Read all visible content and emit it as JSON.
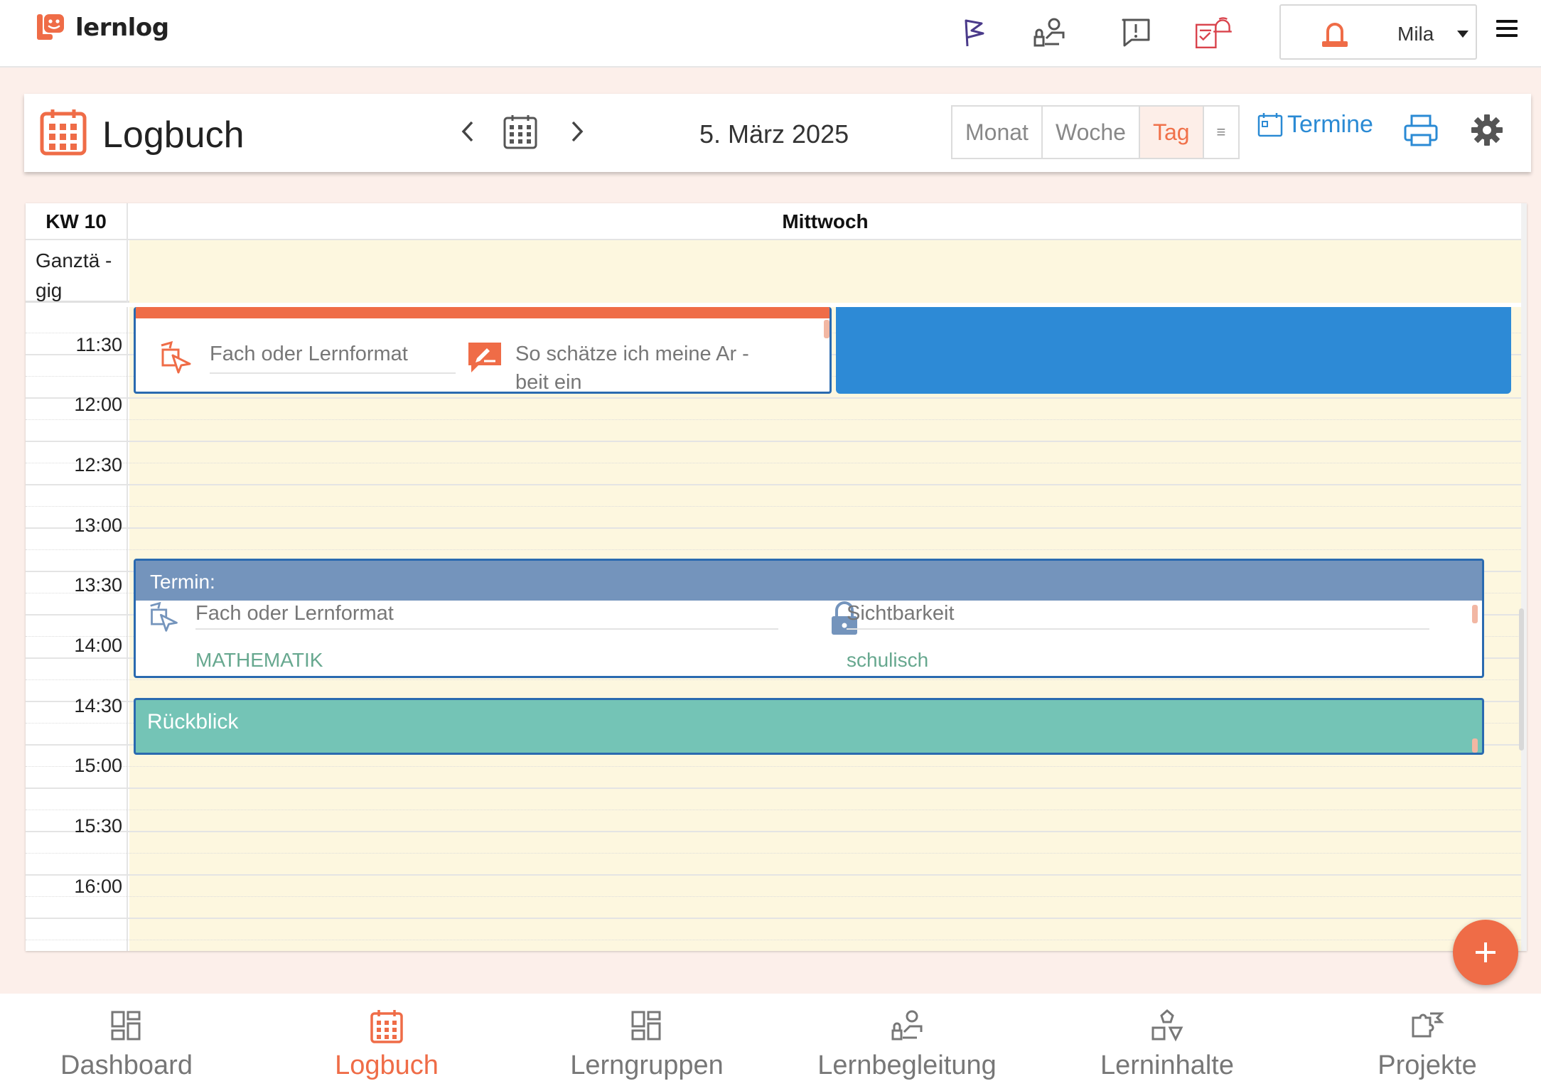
{
  "app": {
    "name": "lernlog"
  },
  "user": {
    "name": "Mila"
  },
  "header": {
    "title": "Logbuch",
    "date": "5. März 2025",
    "views": [
      "Monat",
      "Woche",
      "Tag",
      "≡"
    ],
    "active_view": "Tag",
    "termine_label": "Termine"
  },
  "calendar": {
    "week_label": "KW 10",
    "day_name": "Mittwoch",
    "allday_label": "Ganztä - gig",
    "times": [
      "11:30",
      "12:00",
      "12:30",
      "13:00",
      "13:30",
      "14:00",
      "14:30",
      "15:00",
      "15:30",
      "16:00"
    ]
  },
  "events": {
    "lernzeit": {
      "field1_label": "Fach oder Lernformat",
      "field2_label": "So schätze ich meine Ar -",
      "field2_label_cont": "beit ein"
    },
    "termin": {
      "title": "Termin:",
      "subject_label": "Fach oder Lernformat",
      "subject_value": "MATHEMATIK",
      "visibility_label": "Sichtbarkeit",
      "visibility_value": "schulisch"
    },
    "rueckblick": {
      "title": "Rückblick"
    }
  },
  "bottom_nav": [
    {
      "label": "Dashboard",
      "icon": "dashboard-icon"
    },
    {
      "label": "Logbuch",
      "icon": "calendar-icon"
    },
    {
      "label": "Lerngruppen",
      "icon": "groups-icon"
    },
    {
      "label": "Lernbegleitung",
      "icon": "mentoring-icon"
    },
    {
      "label": "Lerninhalte",
      "icon": "shapes-icon"
    },
    {
      "label": "Projekte",
      "icon": "puzzle-icon"
    }
  ],
  "active_nav": "Logbuch",
  "colors": {
    "accent": "#ef6c47",
    "link": "#2a8ad4",
    "termin_header": "#7494bc",
    "rueckblick": "#74c4b6",
    "event_blue": "#2d8ad6",
    "day_background": "#fdf7df"
  }
}
